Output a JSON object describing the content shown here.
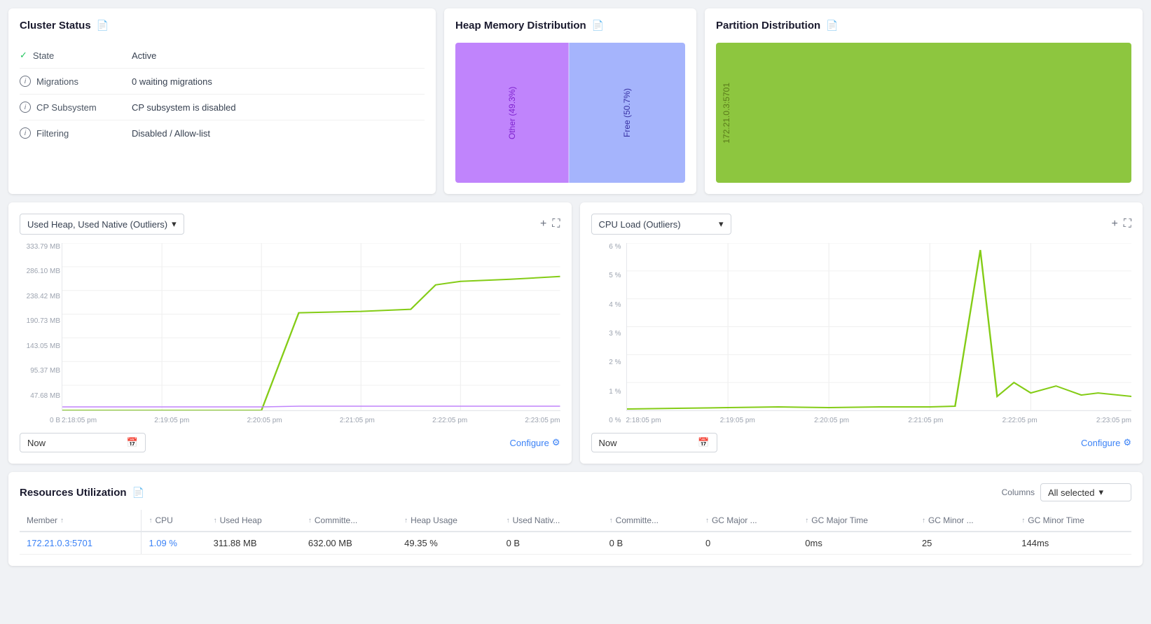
{
  "clusterStatus": {
    "title": "Cluster Status",
    "state": {
      "label": "State",
      "value": "Active"
    },
    "migrations": {
      "label": "Migrations",
      "value": "0 waiting migrations"
    },
    "cpSubsystem": {
      "label": "CP Subsystem",
      "value": "CP subsystem is disabled"
    },
    "filtering": {
      "label": "Filtering",
      "value": "Disabled / Allow-list"
    }
  },
  "heapMemory": {
    "title": "Heap Memory Distribution",
    "other": "Other (49.3%)",
    "free": "Free (50.7%)"
  },
  "partitionDistribution": {
    "title": "Partition Distribution",
    "label": "172.21.0.3:5701"
  },
  "usedHeapChart": {
    "title": "Used Heap, Used Native (Outliers)",
    "yAxis": [
      "333.79 MB",
      "286.10 MB",
      "238.42 MB",
      "190.73 MB",
      "143.05 MB",
      "95.37 MB",
      "47.68 MB",
      "0 B"
    ],
    "xAxis": [
      "2:18:05 pm",
      "2:19:05 pm",
      "2:20:05 pm",
      "2:21:05 pm",
      "2:22:05 pm",
      "2:23:05 pm"
    ],
    "timeLabel": "Now",
    "configurLabel": "Configure"
  },
  "cpuChart": {
    "title": "CPU Load (Outliers)",
    "yAxis": [
      "6 %",
      "5 %",
      "4 %",
      "3 %",
      "2 %",
      "1 %",
      "0 %"
    ],
    "xAxis": [
      "2:18:05 pm",
      "2:19:05 pm",
      "2:20:05 pm",
      "2:21:05 pm",
      "2:22:05 pm",
      "2:23:05 pm"
    ],
    "timeLabel": "Now",
    "configureLabel": "Configure"
  },
  "resourcesTable": {
    "title": "Resources Utilization",
    "columnsLabel": "Columns",
    "columnsValue": "All selected",
    "columns": [
      "Member",
      "CPU",
      "Used Heap",
      "Committe...",
      "Heap Usage",
      "Used Nativ...",
      "Committe...",
      "GC Major ...",
      "GC Major Time",
      "GC Minor ...",
      "GC Minor Time"
    ],
    "rows": [
      {
        "member": "172.21.0.3:5701",
        "cpu": "1.09 %",
        "usedHeap": "311.88 MB",
        "committed": "632.00 MB",
        "heapUsage": "49.35 %",
        "usedNative": "0 B",
        "nativeCommitted": "0 B",
        "gcMajor": "0",
        "gcMajorTime": "0ms",
        "gcMinor": "25",
        "gcMinorTime": "144ms"
      }
    ]
  },
  "icons": {
    "document": "📄",
    "checkCircle": "✓",
    "infoCircle": "i",
    "chevronDown": "▾",
    "plus": "+",
    "expand": "⛶",
    "calendar": "📅",
    "gear": "⚙",
    "sortUp": "↑"
  }
}
